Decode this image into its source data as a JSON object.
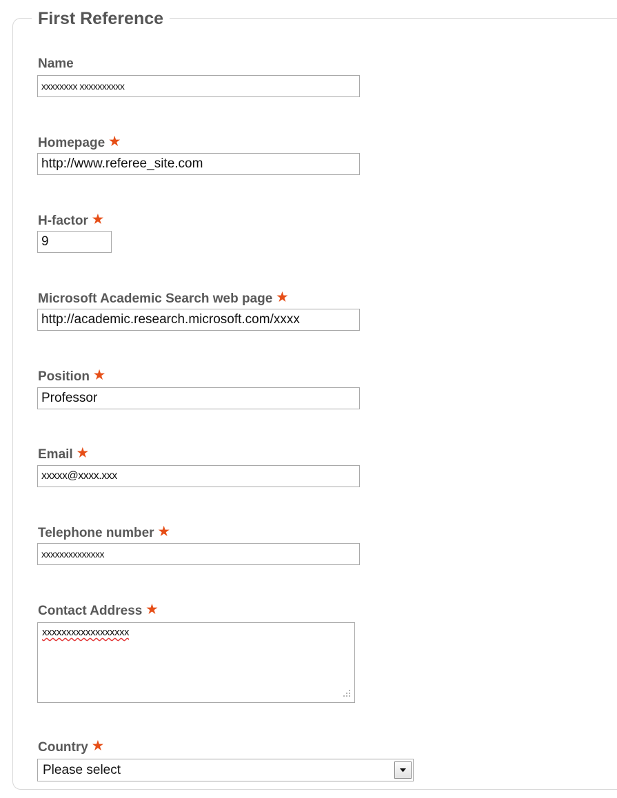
{
  "section": {
    "title": "First Reference"
  },
  "required_marker": "★",
  "fields": {
    "name": {
      "label": "Name",
      "value": "xxxxxxxx xxxxxxxxxx"
    },
    "homepage": {
      "label": "Homepage",
      "value": "http://www.referee_site.com"
    },
    "hfactor": {
      "label": "H-factor",
      "value": "9"
    },
    "msas": {
      "label": "Microsoft Academic Search web page",
      "value": "http://academic.research.microsoft.com/xxxx"
    },
    "position": {
      "label": "Position",
      "value": "Professor"
    },
    "email": {
      "label": "Email",
      "value": "xxxxx@xxxx.xxx"
    },
    "telephone": {
      "label": "Telephone number",
      "value": "xxxxxxxxxxxxxx"
    },
    "address": {
      "label": "Contact Address",
      "value": "xxxxxxxxxxxxxxxxxx"
    },
    "country": {
      "label": "Country",
      "value": "Please select"
    }
  },
  "colors": {
    "required_star": "#e64e17",
    "label": "#585858",
    "border": "#a9a9a9"
  },
  "icons": {
    "required": "star-icon",
    "dropdown": "chevron-down-icon",
    "resize": "resize-grip-icon"
  }
}
